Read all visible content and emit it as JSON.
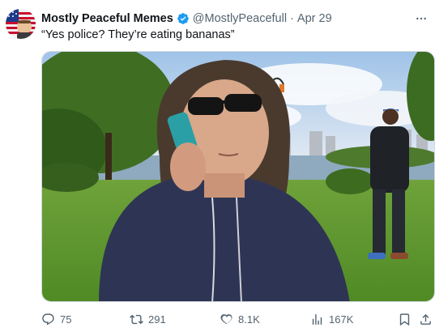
{
  "tweet": {
    "author_name": "Mostly Peaceful Memes",
    "handle": "@MostlyPeacefull",
    "separator": "·",
    "date": "Apr 29",
    "text": "“Yes police? They’re eating bananas”",
    "verified": true
  },
  "media": {
    "type": "photo",
    "description_icon": "photo-icon"
  },
  "actions": {
    "reply_count": "75",
    "retweet_count": "291",
    "like_count": "8.1K",
    "view_count": "167K"
  },
  "colors": {
    "verified_blue": "#1d9bf0",
    "secondary_text": "#536471",
    "primary_text": "#0f1419"
  }
}
